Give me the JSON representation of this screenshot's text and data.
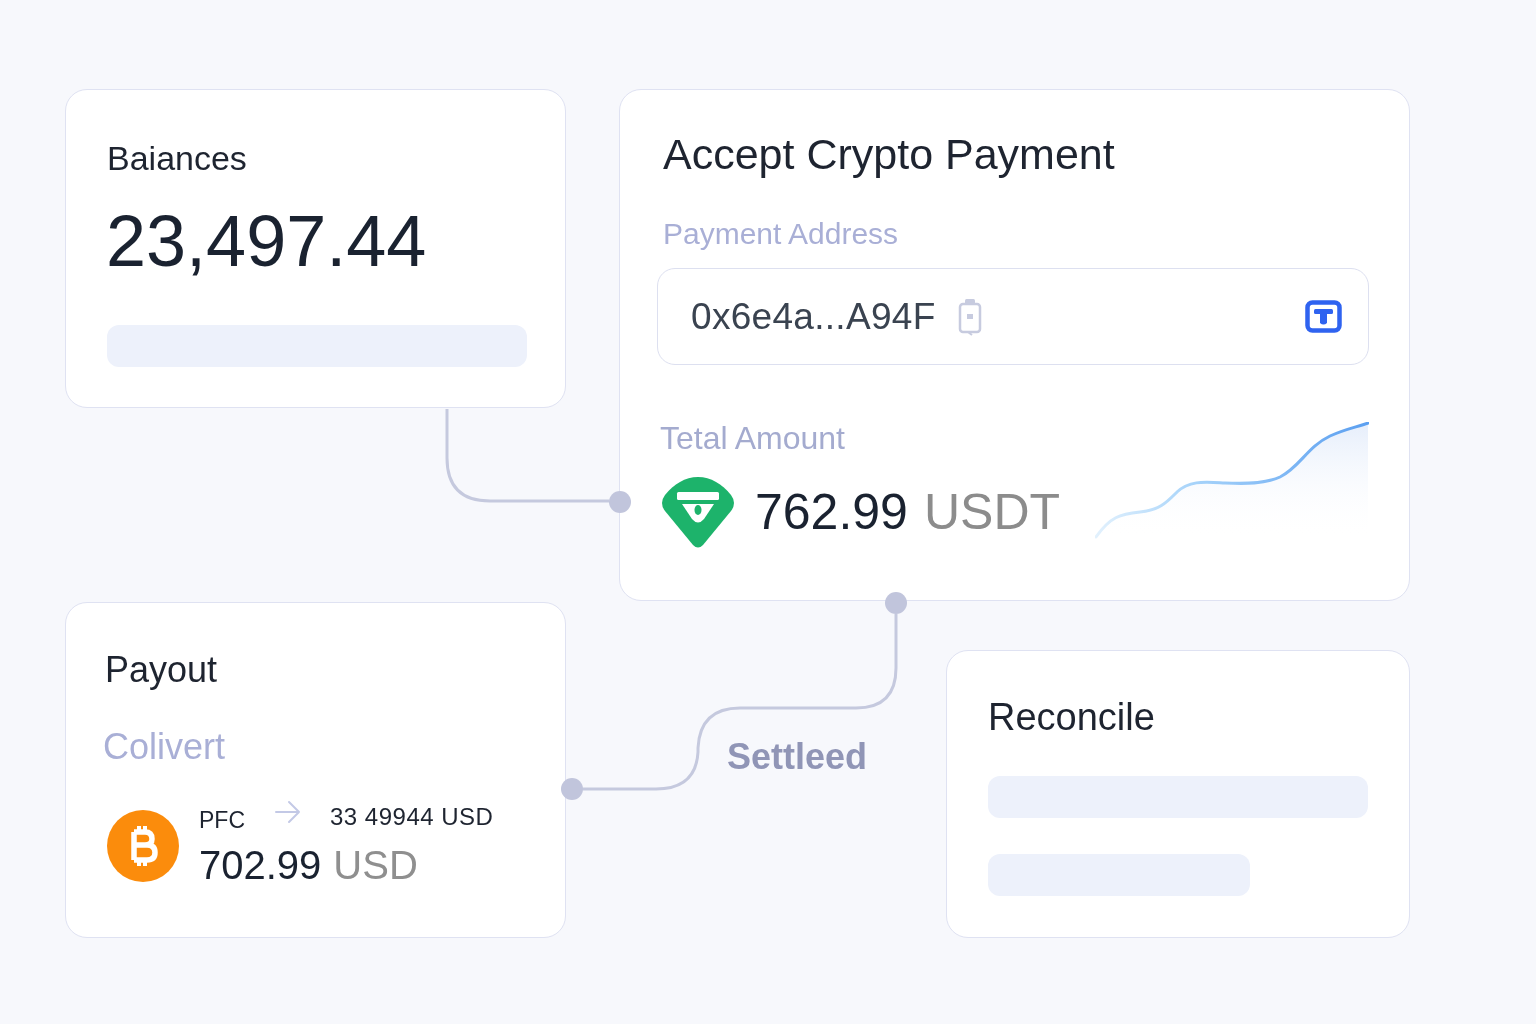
{
  "balances_card": {
    "title": "Baiances",
    "amount": "23,497.44"
  },
  "payment_card": {
    "title": "Accept Crypto Payment",
    "address_label": "Payment Address",
    "address": "0x6e4a...A94F",
    "amount_label": "Tetal Amount",
    "amount": "762.99",
    "currency": "USDT"
  },
  "payout_card": {
    "title": "Payout",
    "subtitle": "Colivert",
    "from": "PFC",
    "to": "33 49944 USD",
    "amount": "702.99",
    "currency": "USD"
  },
  "reconcile_card": {
    "title": "Reconcile"
  },
  "flow_label": "Settleed"
}
